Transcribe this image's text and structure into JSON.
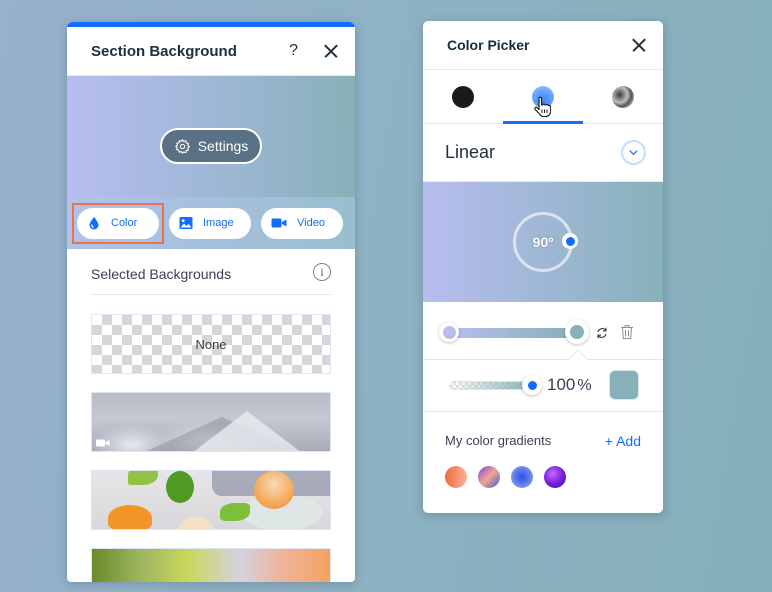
{
  "section_background": {
    "title": "Section Background",
    "help_label": "?",
    "close_icon": "close-icon",
    "settings_button": "Settings",
    "type_buttons": [
      {
        "label": "Color",
        "icon": "droplet-icon",
        "active": true
      },
      {
        "label": "Image",
        "icon": "image-icon",
        "active": false
      },
      {
        "label": "Video",
        "icon": "video-camera-icon",
        "active": false
      }
    ],
    "selected_title": "Selected Backgrounds",
    "info_label": "i",
    "thumbnails": [
      {
        "label": "None",
        "kind": "none"
      },
      {
        "label": "",
        "kind": "video-mountain"
      },
      {
        "label": "",
        "kind": "image-citrus"
      },
      {
        "label": "",
        "kind": "gradient"
      }
    ],
    "accent_color": "#116dff",
    "highlight_color": "#f06f53"
  },
  "color_picker": {
    "title": "Color Picker",
    "tabs": [
      {
        "name": "solid",
        "active": false
      },
      {
        "name": "gradient",
        "active": true
      },
      {
        "name": "fluid",
        "active": false
      }
    ],
    "gradient_type": "Linear",
    "angle_label": "90º",
    "angle_degrees": 90,
    "gradient_stops": [
      {
        "color": "#b8bdef",
        "position": 0
      },
      {
        "color": "#87b1b8",
        "position": 100
      }
    ],
    "opacity_value": "100",
    "opacity_unit": "%",
    "selected_color": "#87b1b8",
    "my_gradients_title": "My color gradients",
    "add_label": "+ Add",
    "saved_gradients": [
      "orange-peach",
      "purple-peach-blue",
      "blue-radial",
      "violet-sphere"
    ]
  }
}
